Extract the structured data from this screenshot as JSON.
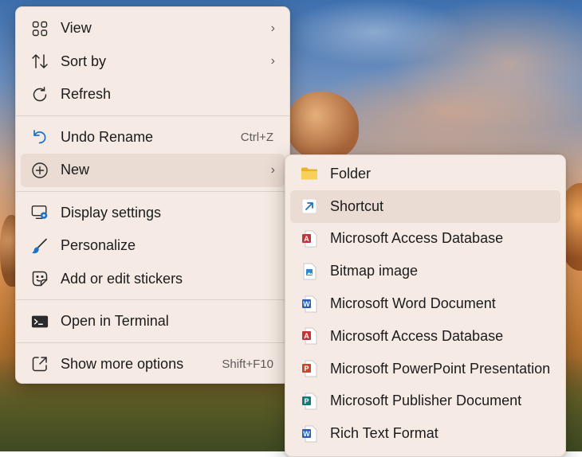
{
  "context_menu": {
    "items": [
      {
        "label": "View",
        "icon": "view-grid-icon",
        "submenu": true
      },
      {
        "label": "Sort by",
        "icon": "sort-icon",
        "submenu": true
      },
      {
        "label": "Refresh",
        "icon": "refresh-icon"
      },
      {
        "label": "Undo Rename",
        "icon": "undo-icon",
        "shortcut": "Ctrl+Z"
      },
      {
        "label": "New",
        "icon": "new-plus-icon",
        "submenu": true,
        "highlighted": true
      },
      {
        "label": "Display settings",
        "icon": "display-settings-icon"
      },
      {
        "label": "Personalize",
        "icon": "brush-icon"
      },
      {
        "label": "Add or edit stickers",
        "icon": "sticker-icon"
      },
      {
        "label": "Open in Terminal",
        "icon": "terminal-icon"
      },
      {
        "label": "Show more options",
        "icon": "more-options-icon",
        "shortcut": "Shift+F10"
      }
    ]
  },
  "new_submenu": {
    "items": [
      {
        "label": "Folder",
        "icon": "folder-icon"
      },
      {
        "label": "Shortcut",
        "icon": "shortcut-arrow-icon",
        "highlighted": true
      },
      {
        "label": "Microsoft Access Database",
        "icon": "access-file-icon"
      },
      {
        "label": "Bitmap image",
        "icon": "bitmap-file-icon"
      },
      {
        "label": "Microsoft Word Document",
        "icon": "word-file-icon"
      },
      {
        "label": "Microsoft Access Database",
        "icon": "access-file-icon"
      },
      {
        "label": "Microsoft PowerPoint Presentation",
        "icon": "powerpoint-file-icon"
      },
      {
        "label": "Microsoft Publisher Document",
        "icon": "publisher-file-icon"
      },
      {
        "label": "Rich Text Format",
        "icon": "rtf-file-icon"
      }
    ]
  },
  "colors": {
    "menu_background": "#f6ebe4",
    "highlight": "#eadbd3",
    "accent_blue": "#1a73c8",
    "access_red": "#c4323a",
    "powerpoint_orange": "#c8462a",
    "word_blue": "#2b5cb8",
    "publisher_teal": "#0f7b7b",
    "folder_yellow": "#f2c744"
  }
}
